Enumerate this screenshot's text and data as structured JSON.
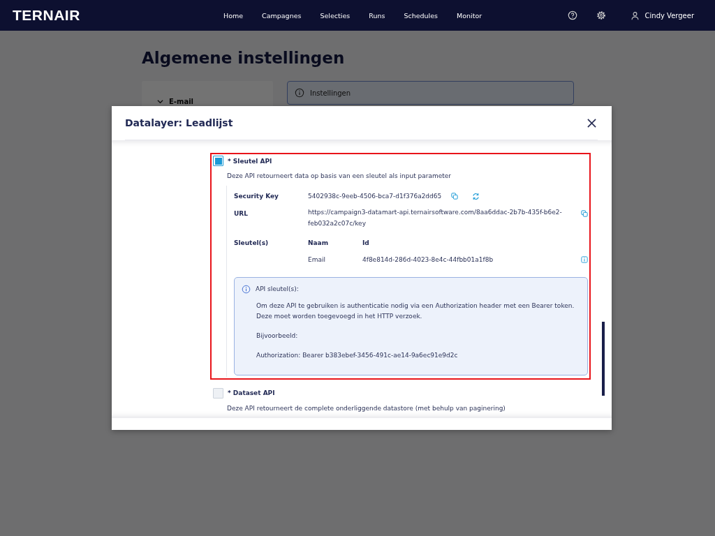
{
  "nav": {
    "logo": "TERNAIR",
    "links": [
      "Home",
      "Campagnes",
      "Selecties",
      "Runs",
      "Schedules",
      "Monitor"
    ],
    "user": "Cindy Vergeer"
  },
  "page": {
    "title": "Algemene instellingen",
    "sidebar_item": "E-mail",
    "info_label": "Instellingen"
  },
  "modal": {
    "title": "Datalayer: Leadlijst",
    "apis": [
      {
        "label": "* Sleutel API",
        "checked": true,
        "highlighted": true,
        "description": "Deze API retourneert data op basis van een sleutel als input parameter",
        "details": {
          "security_key_label": "Security Key",
          "security_key": "5402938c-9eeb-4506-bca7-d1f376a2dd65",
          "url_label": "URL",
          "url": "https://campaign3-datamart-api.ternairsoftware.com/8aa6ddac-2b7b-435f-b6e2-feb032a2c07c/key",
          "keys_label": "Sleutel(s)",
          "name_header": "Naam",
          "id_header": "Id",
          "keys": [
            {
              "name": "Email",
              "id": "4f8e814d-286d-4023-8e4c-44fbb01a1f8b"
            }
          ],
          "info": {
            "title": "API sleutel(s):",
            "paragraphs": [
              "Om deze API te gebruiken is authenticatie nodig via een Authorization header met een Bearer token. Deze moet worden toegevoegd in het HTTP verzoek.",
              "Bijvoorbeeld:",
              "Authorization: Bearer b383ebef-3456-491c-ae14-9a6ec91e9d2c"
            ]
          }
        }
      },
      {
        "label": "* Dataset API",
        "checked": false,
        "highlighted": false,
        "description": "Deze API retourneert de complete onderliggende datastore (met behulp van paginering)"
      }
    ]
  }
}
